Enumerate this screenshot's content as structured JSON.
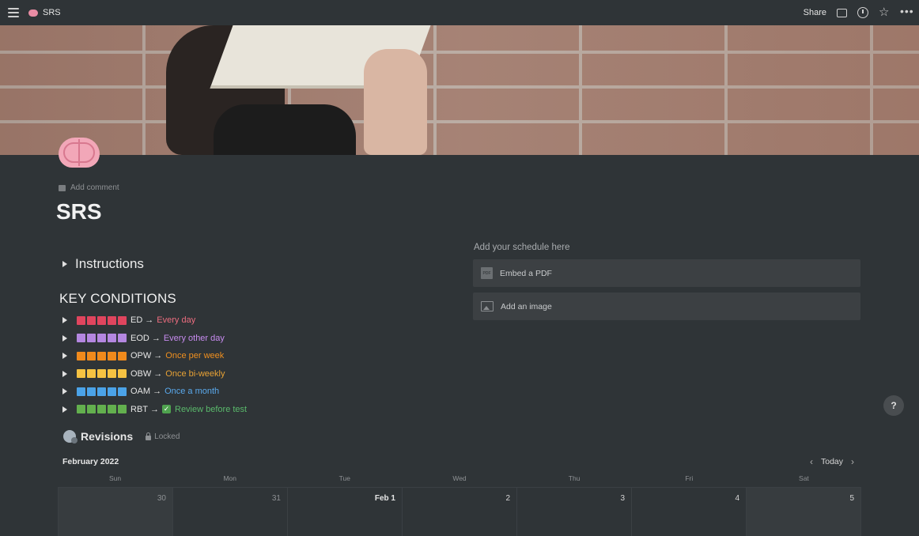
{
  "topbar": {
    "title": "SRS",
    "share_label": "Share"
  },
  "icons": [
    "menu-icon",
    "brain-icon",
    "comment-icon",
    "clock-icon",
    "star-icon",
    "more-icon",
    "pdf-icon",
    "image-icon",
    "lock-icon",
    "help-icon"
  ],
  "page": {
    "add_comment": "Add comment",
    "title": "SRS"
  },
  "instructions": {
    "label": "Instructions"
  },
  "key_conditions": {
    "heading": "KEY CONDITIONS",
    "items": [
      {
        "code": "ED",
        "arrow": "→",
        "desc": "Every day",
        "color": "#e0455e",
        "desc_color": "#ec6d7f",
        "check": false
      },
      {
        "code": "EOD",
        "arrow": "→",
        "desc": "Every other day",
        "color": "#b487e0",
        "desc_color": "#c78bef",
        "check": false
      },
      {
        "code": "OPW",
        "arrow": "→",
        "desc": "Once per week",
        "color": "#f08a1c",
        "desc_color": "#f0901f",
        "check": false
      },
      {
        "code": "OBW",
        "arrow": "→",
        "desc": "Once bi-weekly",
        "color": "#f5c242",
        "desc_color": "#e8a235",
        "check": false
      },
      {
        "code": "OAM",
        "arrow": "→",
        "desc": "Once a month",
        "color": "#4ba3e8",
        "desc_color": "#5aa9ec",
        "check": false
      },
      {
        "code": "RBT",
        "arrow": "→",
        "desc": "Review before test",
        "color": "#63b04e",
        "desc_color": "#5ab96b",
        "check": true
      }
    ]
  },
  "schedule": {
    "label": "Add your schedule here",
    "embed_pdf": "Embed a PDF",
    "add_image": "Add an image",
    "pdf_icon_text": "PDF"
  },
  "revisions": {
    "title": "Revisions",
    "locked": "Locked"
  },
  "calendar": {
    "month": "February 2022",
    "today": "Today",
    "days": [
      "Sun",
      "Mon",
      "Tue",
      "Wed",
      "Thu",
      "Fri",
      "Sat"
    ],
    "dates": [
      "30",
      "31",
      "Feb 1",
      "2",
      "3",
      "4",
      "5"
    ]
  },
  "help": {
    "label": "?"
  }
}
